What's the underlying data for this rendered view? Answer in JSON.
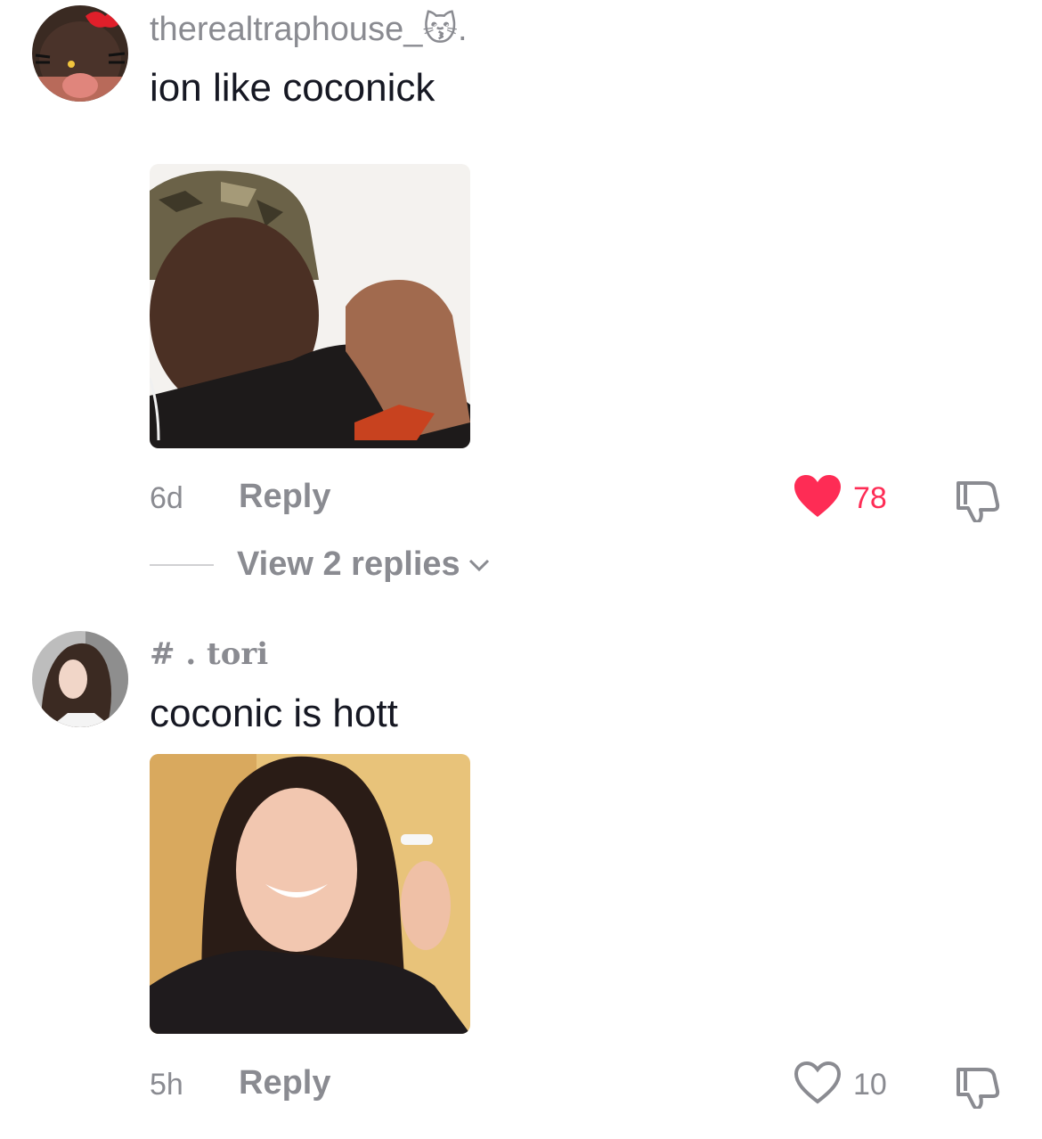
{
  "comments": [
    {
      "username": "therealtraphouse_😽.",
      "text": "ion like coconick",
      "time": "6d",
      "reply_label": "Reply",
      "likes": "78",
      "liked": true,
      "view_replies": "View 2 replies"
    },
    {
      "username": "# . tori",
      "text": "coconic is hott",
      "time": "5h",
      "reply_label": "Reply",
      "likes": "10",
      "liked": false
    }
  ],
  "colors": {
    "like_active": "#fe2c55",
    "muted": "#8a8b91",
    "text": "#161823"
  },
  "icons": {
    "liked": "heart-filled-icon",
    "not_liked": "heart-outline-icon",
    "dislike": "thumbs-down-icon",
    "expand": "chevron-down-icon"
  }
}
